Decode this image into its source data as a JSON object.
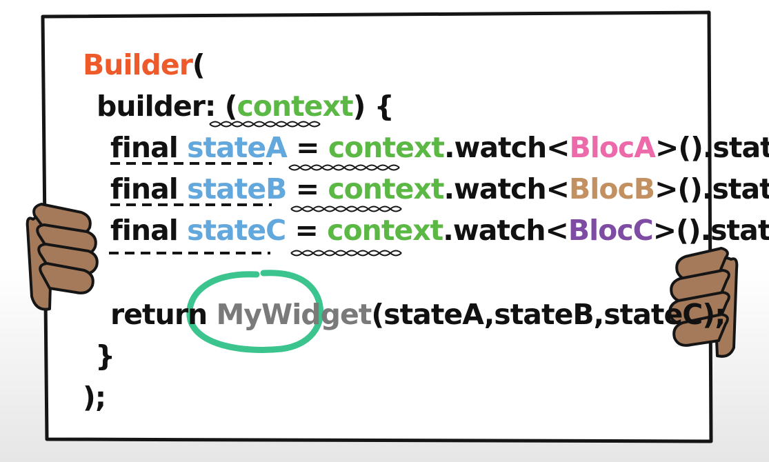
{
  "colors": {
    "builder": "#ee5a2a",
    "context": "#5cb845",
    "variable": "#63a8dc",
    "bloc_a": "#ec6aa9",
    "bloc_b": "#c39062",
    "bloc_c": "#7e4da3",
    "widget": "#7a7a7a",
    "highlight_circle": "#3cc48e",
    "hand": "#a47a5b",
    "outline": "#151515"
  },
  "code": {
    "line1": {
      "builder": "Builder",
      "open": "("
    },
    "line2": {
      "prefix": "builder: (",
      "context": "context",
      "suffix": ") {"
    },
    "line3": {
      "final": "final",
      "var": "stateA",
      "eq": " = ",
      "context": "context",
      "watch_open": ".watch<",
      "bloc": "BlocA",
      "watch_close": ">().state;"
    },
    "line4": {
      "final": "final",
      "var": "stateB",
      "eq": " = ",
      "context": "context",
      "watch_open": ".watch<",
      "bloc": "BlocB",
      "watch_close": ">().state;"
    },
    "line5": {
      "final": "final",
      "var": "stateC",
      "eq": " = ",
      "context": "context",
      "watch_open": ".watch<",
      "bloc": "BlocC",
      "watch_close": ">().state;"
    },
    "line6": {
      "return": "return ",
      "widget": "MyWidget",
      "args": "(stateA,stateB,stateC);"
    },
    "line7": {
      "brace": "}"
    },
    "line8": {
      "close": ");"
    }
  }
}
